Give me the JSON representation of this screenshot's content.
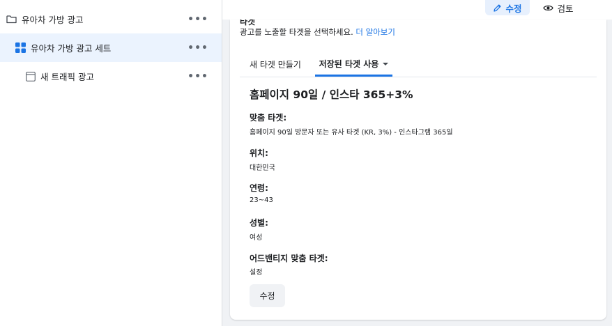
{
  "tree": {
    "items": [
      {
        "label": "유아차 가방 광고",
        "icon": "folder-icon",
        "more": "•••"
      },
      {
        "label": "유아차 가방 광고 세트",
        "icon": "ad-set-grid-icon",
        "more": "•••"
      },
      {
        "label": "새 트래픽 광고",
        "icon": "ad-window-icon",
        "more": "•••"
      }
    ]
  },
  "topbar": {
    "edit_label": "수정",
    "review_label": "검토"
  },
  "audience": {
    "section_cut_label": "타겟",
    "description": "광고를 노출할 타겟을 선택하세요.",
    "learn_more": "더 알아보기",
    "tabs": [
      {
        "label": "새 타겟 만들기"
      },
      {
        "label": "저장된 타겟 사용"
      }
    ],
    "title": "홈페이지 90일 / 인스타 365+3%",
    "fields": [
      {
        "label": "맞춤 타겟:",
        "value": "홈페이지 90일 방문자 또는 유사 타겟 (KR, 3%) - 인스타그램 365일"
      },
      {
        "label": "위치:",
        "value": "대한민국"
      },
      {
        "label": "연령:",
        "value": "23~43"
      },
      {
        "label": "성별:",
        "value": "여성"
      },
      {
        "label": "어드밴티지 맞춤 타겟:",
        "value": "설정"
      }
    ],
    "edit_button": "수정"
  },
  "colors": {
    "accent": "#1b74e4",
    "selected_bg": "#ebf3fe",
    "panel_bg": "#f0f2f5"
  }
}
